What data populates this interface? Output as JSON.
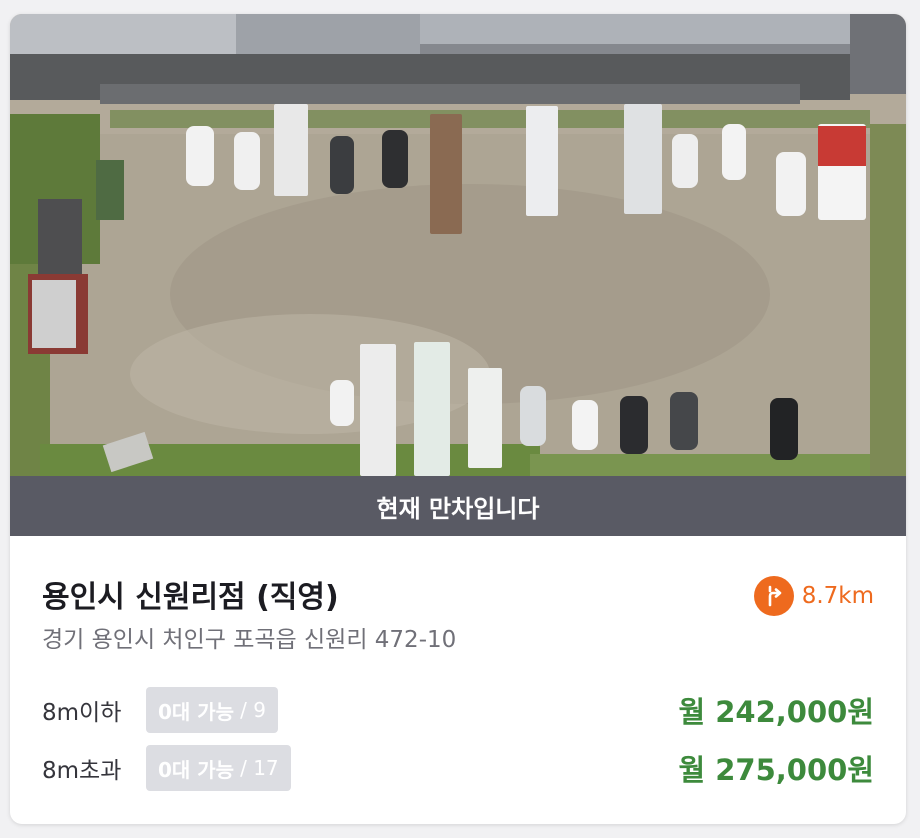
{
  "status_banner": "현재 만차입니다",
  "lot": {
    "name": "용인시 신원리점 (직영)",
    "address": "경기 용인시 처인구 포곡읍 신원리 472-10",
    "distance": "8.7km"
  },
  "rates": [
    {
      "label": "8m이하",
      "availability": "0대 가능",
      "capacity": "/ 9",
      "price": "월 242,000원"
    },
    {
      "label": "8m초과",
      "availability": "0대 가능",
      "capacity": "/ 17",
      "price": "월 275,000원"
    }
  ],
  "colors": {
    "accent_orange": "#ee6a1e",
    "price_green": "#3d8a3c",
    "status_bar": "#595a64",
    "badge_bg": "#dcdde2"
  },
  "icons": {
    "distance": "directions-icon"
  }
}
